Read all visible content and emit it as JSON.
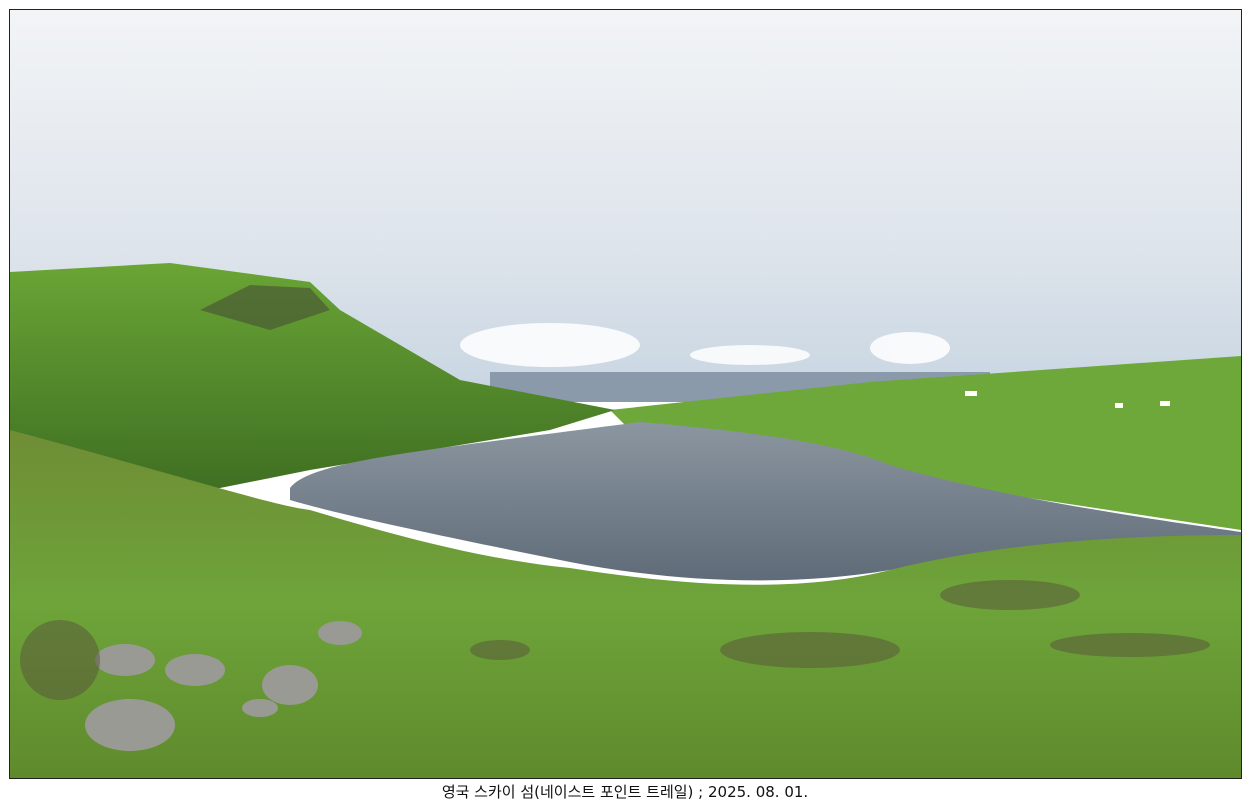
{
  "photo": {
    "caption": "영국 스카이 섬(네이스트 포인트 트레일) ; 2025. 08. 01."
  },
  "colors": {
    "sky": "#e8ecf0",
    "grass": "#5f9a2c",
    "lake": "#6a7580",
    "sea": "#8a9aaa"
  }
}
